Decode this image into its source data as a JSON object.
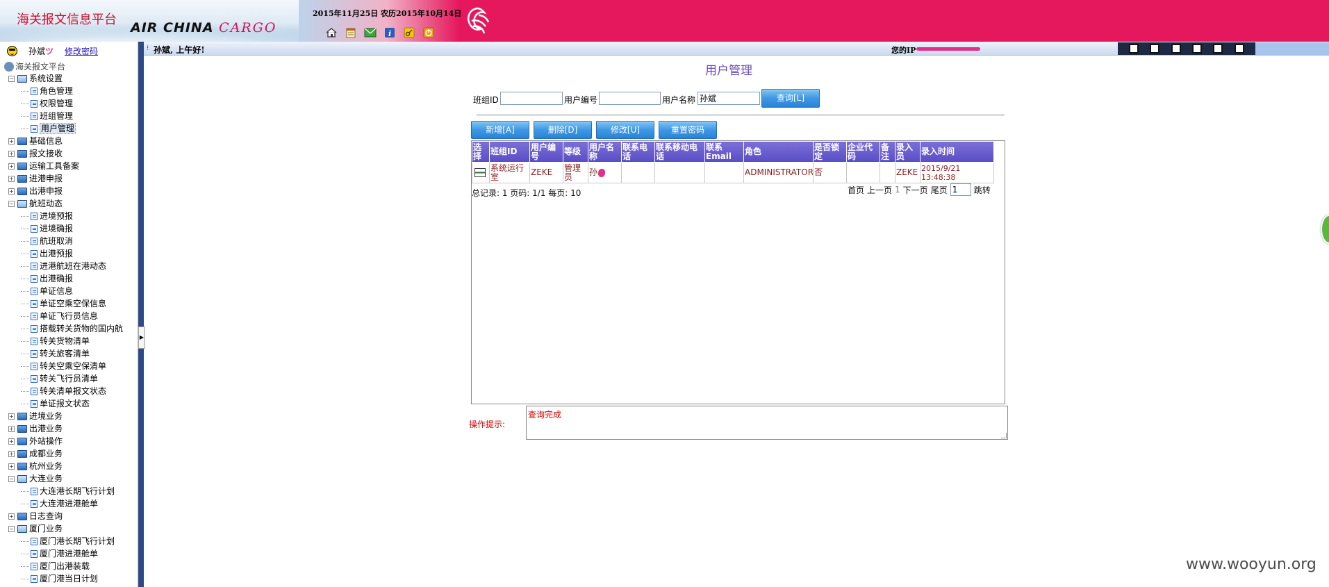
{
  "header": {
    "app_title": "海关报文信息平台",
    "brand_main": "AIR CHINA ",
    "brand_cargo": "CARGO",
    "date_text": "2015年11月25日  农历2015年10月14日",
    "toolbar_icons": [
      "home-icon",
      "calendar-icon",
      "mail-icon",
      "info-icon",
      "key-icon",
      "exit-icon"
    ]
  },
  "sidebar": {
    "user_name": "孙斌",
    "change_password": "修改密码",
    "root": "海关报文平台",
    "tree": [
      {
        "label": "系统设置",
        "expanded": true,
        "children": [
          {
            "label": "角色管理"
          },
          {
            "label": "权限管理"
          },
          {
            "label": "班组管理"
          },
          {
            "label": "用户管理",
            "selected": true
          }
        ]
      },
      {
        "label": "基础信息",
        "expanded": false
      },
      {
        "label": "报文接收",
        "expanded": false
      },
      {
        "label": "运输工具备案",
        "expanded": false
      },
      {
        "label": "进港申报",
        "expanded": false
      },
      {
        "label": "出港申报",
        "expanded": false
      },
      {
        "label": "航班动态",
        "expanded": true,
        "children": [
          {
            "label": "进境预报"
          },
          {
            "label": "进境确报"
          },
          {
            "label": "航班取消"
          },
          {
            "label": "出港预报"
          },
          {
            "label": "进港航班在港动态"
          },
          {
            "label": "出港确报"
          },
          {
            "label": "单证信息"
          },
          {
            "label": "单证空乘空保信息"
          },
          {
            "label": "单证飞行员信息"
          },
          {
            "label": "搭载转关货物的国内航"
          },
          {
            "label": "转关货物清单"
          },
          {
            "label": "转关旅客清单"
          },
          {
            "label": "转关空乘空保清单"
          },
          {
            "label": "转关飞行员清单"
          },
          {
            "label": "转关清单报文状态"
          },
          {
            "label": "单证报文状态"
          }
        ]
      },
      {
        "label": "进境业务",
        "expanded": false
      },
      {
        "label": "出港业务",
        "expanded": false
      },
      {
        "label": "外站操作",
        "expanded": false
      },
      {
        "label": "成都业务",
        "expanded": false
      },
      {
        "label": "杭州业务",
        "expanded": false
      },
      {
        "label": "大连业务",
        "expanded": true,
        "children": [
          {
            "label": "大连港长期飞行计划"
          },
          {
            "label": "大连港进港舱单"
          }
        ]
      },
      {
        "label": "日志查询",
        "expanded": false
      },
      {
        "label": "厦门业务",
        "expanded": true,
        "children": [
          {
            "label": "厦门港长期飞行计划"
          },
          {
            "label": "厦门港进港舱单"
          },
          {
            "label": "厦门出港装载"
          },
          {
            "label": "厦门港当日计划"
          }
        ]
      }
    ]
  },
  "topbar": {
    "greeting": "孙斌, 上午好!",
    "ip_label": "您的IP"
  },
  "main": {
    "title": "用户管理",
    "filters": {
      "group_id_label": "班组ID",
      "group_id_value": "",
      "user_no_label": "用户编号",
      "user_no_value": "",
      "user_name_label": "用户名称",
      "user_name_value": "孙斌",
      "query_button": "查询[L]"
    },
    "actions": {
      "add": "新增[A]",
      "delete": "删除[D]",
      "edit": "修改[U]",
      "reset_password": "重置密码"
    },
    "table": {
      "columns": [
        "选择",
        "班组ID",
        "用户编号",
        "等级",
        "用户名称",
        "联系电话",
        "联系移动电话",
        "联系Email",
        "角色",
        "是否锁定",
        "企业代码",
        "备注",
        "录入员",
        "录入时间"
      ],
      "rows": [
        {
          "group_id": "系统运行室",
          "user_no": "ZEKE",
          "level": "管理员",
          "user_name": "孙",
          "phone": "",
          "mobile": "",
          "email": "",
          "role": "ADMINISTRATOR",
          "locked": "否",
          "company_code": "",
          "remark": "",
          "operator": "ZEKE",
          "created": "2015/9/21 13:48:38"
        }
      ]
    },
    "summary": "总记录: 1 页码: 1/1 每页: 10",
    "pager": {
      "first": "首页",
      "prev": "上一页",
      "current": "1",
      "next": "下一页",
      "last": "尾页",
      "page_input": "1",
      "jump": "跳转"
    },
    "hint_label": "操作提示:",
    "hint_text": "查询完成"
  },
  "watermark": "www.wooyun.org"
}
